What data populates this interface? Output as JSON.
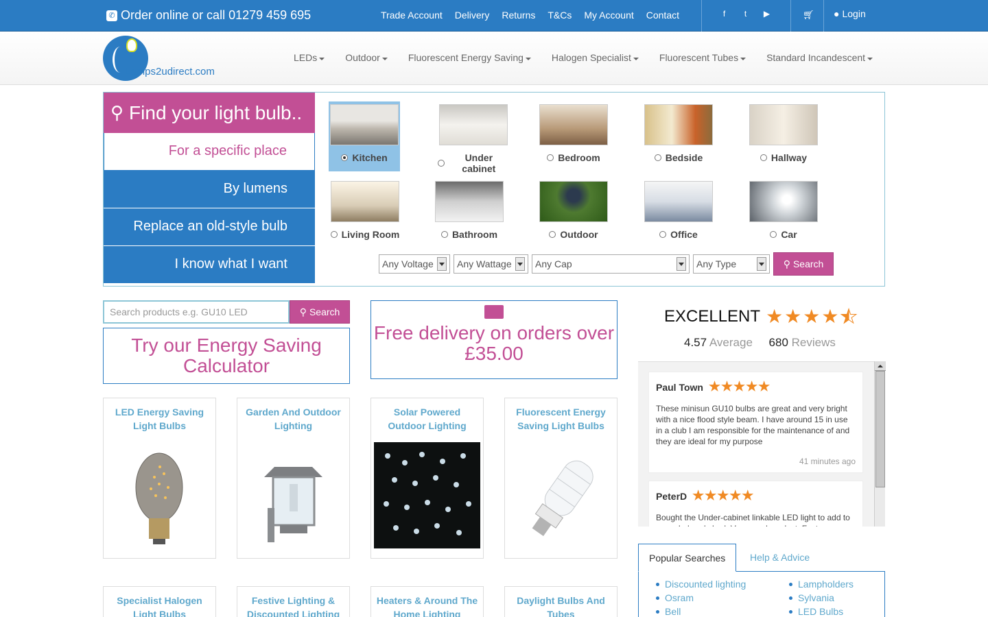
{
  "topbar": {
    "phone": "Order online or call 01279 459 695",
    "links": [
      "Trade Account",
      "Delivery",
      "Returns",
      "T&Cs",
      "My Account",
      "Contact"
    ],
    "social": [
      "facebook-icon",
      "twitter-icon",
      "youtube-icon"
    ],
    "login": "Login"
  },
  "header": {
    "logo": "Lamps2udirect.com",
    "nav": [
      "LEDs",
      "Outdoor",
      "Fluorescent Energy Saving",
      "Halogen Specialist",
      "Fluorescent Tubes",
      "Standard Incandescent"
    ]
  },
  "finder": {
    "title": "Find your light bulb..",
    "tabs": [
      "For a specific place",
      "By lumens",
      "Replace an old-style bulb",
      "I know what I want"
    ],
    "places_row1": [
      "Kitchen",
      "Under cabinet",
      "Bedroom",
      "Bedside",
      "Hallway"
    ],
    "places_row2": [
      "Living Room",
      "Bathroom",
      "Outdoor",
      "Office",
      "Car"
    ],
    "selected_place": "Kitchen",
    "filters": {
      "voltage": "Any Voltage",
      "wattage": "Any Wattage",
      "cap": "Any Cap",
      "type": "Any Type"
    },
    "search": "Search"
  },
  "search": {
    "placeholder": "Search products e.g. GU10 LED",
    "button": "Search"
  },
  "calculator": "Try our Energy Saving Calculator",
  "delivery": "Free delivery on orders over £35.00",
  "categories_row1": [
    "LED Energy Saving Light Bulbs",
    "Garden And Outdoor Lighting",
    "Solar Powered Outdoor Lighting",
    "Fluorescent Energy Saving Light Bulbs"
  ],
  "categories_row2": [
    "Specialist Halogen Light Bulbs",
    "Festive Lighting & Discounted Lighting",
    "Heaters & Around The Home Lighting",
    "Daylight Bulbs And Tubes"
  ],
  "reviews": {
    "rating_word": "EXCELLENT",
    "average": "4.57",
    "average_label": "Average",
    "count": "680",
    "count_label": "Reviews",
    "stars": 4.5,
    "items": [
      {
        "name": "Paul Town",
        "stars": 5,
        "body": "These minisun GU10 bulbs are great and very bright with a nice flood style beam. I have around 15 in use in a club I am responsible for the maintenance of and they are ideal for my purpose",
        "time": "41 minutes ago"
      },
      {
        "name": "PeterD",
        "stars": 5,
        "body": "Bought the Under-cabinet linkable LED light to add to some I already had. Very good product. Fast",
        "time": ""
      }
    ]
  },
  "popular": {
    "tabs": [
      "Popular Searches",
      "Help & Advice"
    ],
    "col1": [
      "Discounted lighting",
      "Osram",
      "Bell"
    ],
    "col2": [
      "Lampholders",
      "Sylvania",
      "LED Bulbs"
    ]
  },
  "colors": {
    "primary": "#2b7cc3",
    "accent": "#c24f95",
    "star": "#f08a24",
    "link": "#5fa8cc"
  }
}
